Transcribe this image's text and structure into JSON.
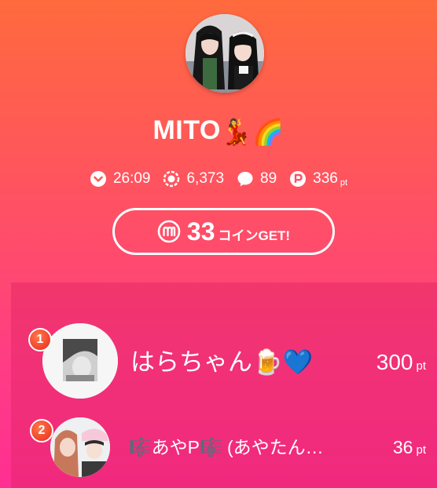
{
  "profile": {
    "name": "MITO",
    "name_emoji": "💃🌈"
  },
  "stats": {
    "time": "26:09",
    "viewers": "6,373",
    "comments": "89",
    "points": "336",
    "points_unit": "pt"
  },
  "coin_button": {
    "count": "33",
    "suffix": "コインGET!"
  },
  "ranking": [
    {
      "rank": "1",
      "name": "はらちゃん🍺💙",
      "points": "300",
      "unit": "pt"
    },
    {
      "rank": "2",
      "name": "🎼あやP🎼 (あやたん…",
      "points": "36",
      "unit": "pt"
    }
  ],
  "icons": {
    "time": "chevron-down-icon",
    "viewers": "viewers-icon",
    "comments": "comment-bubble-icon",
    "points": "points-p-icon",
    "coin": "coin-m-icon"
  },
  "colors": {
    "gradient_top": "#ff6a3d",
    "gradient_bottom": "#ff2f92",
    "panel": "#de2264",
    "badge": "#f0402a"
  }
}
